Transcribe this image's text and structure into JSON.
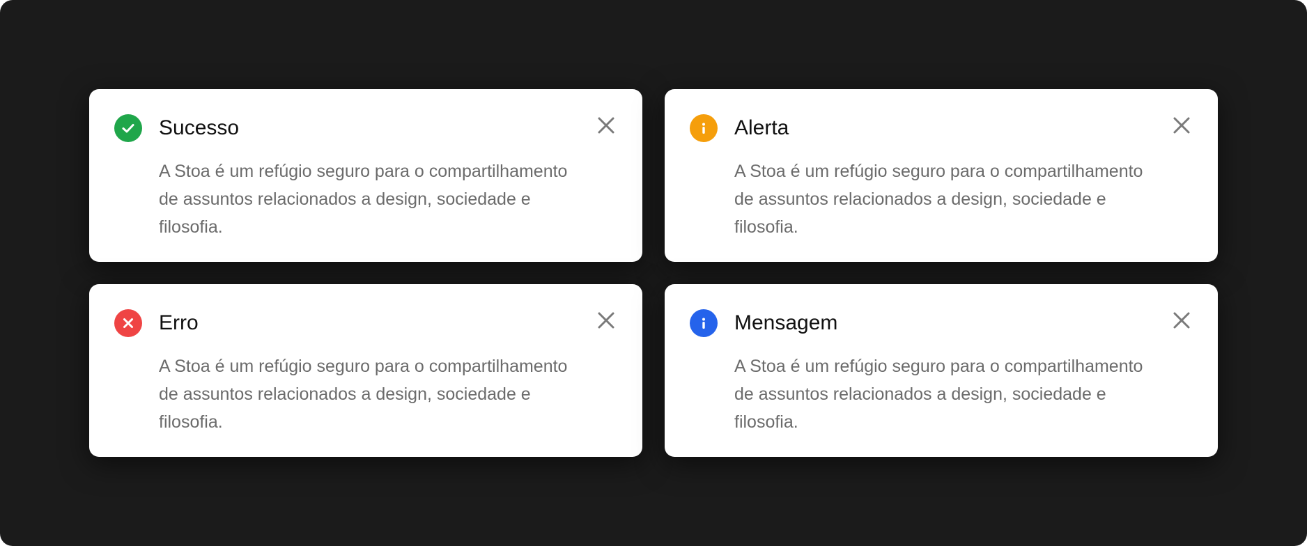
{
  "toasts": [
    {
      "title": "Sucesso",
      "body": "A Stoa é um refúgio seguro para o compartilhamento de assuntos relacionados a design, sociedade e filosofia.",
      "icon": "check-circle-icon",
      "color": "#1fa64a"
    },
    {
      "title": "Alerta",
      "body": "A Stoa é um refúgio seguro para o compartilhamento de assuntos relacionados a design, sociedade e filosofia.",
      "icon": "warning-info-icon",
      "color": "#f59e0b"
    },
    {
      "title": "Erro",
      "body": "A Stoa é um refúgio seguro para o compartilhamento de assuntos relacionados a design, sociedade e filosofia.",
      "icon": "error-x-icon",
      "color": "#ef4444"
    },
    {
      "title": "Mensagem",
      "body": "A Stoa é um refúgio seguro para o compartilhamento de assuntos relacionados a design, sociedade e filosofia.",
      "icon": "info-icon",
      "color": "#2563eb"
    }
  ],
  "close_icon": "close-icon",
  "close_color": "#7a7a7a",
  "background_color": "#1b1b1b"
}
